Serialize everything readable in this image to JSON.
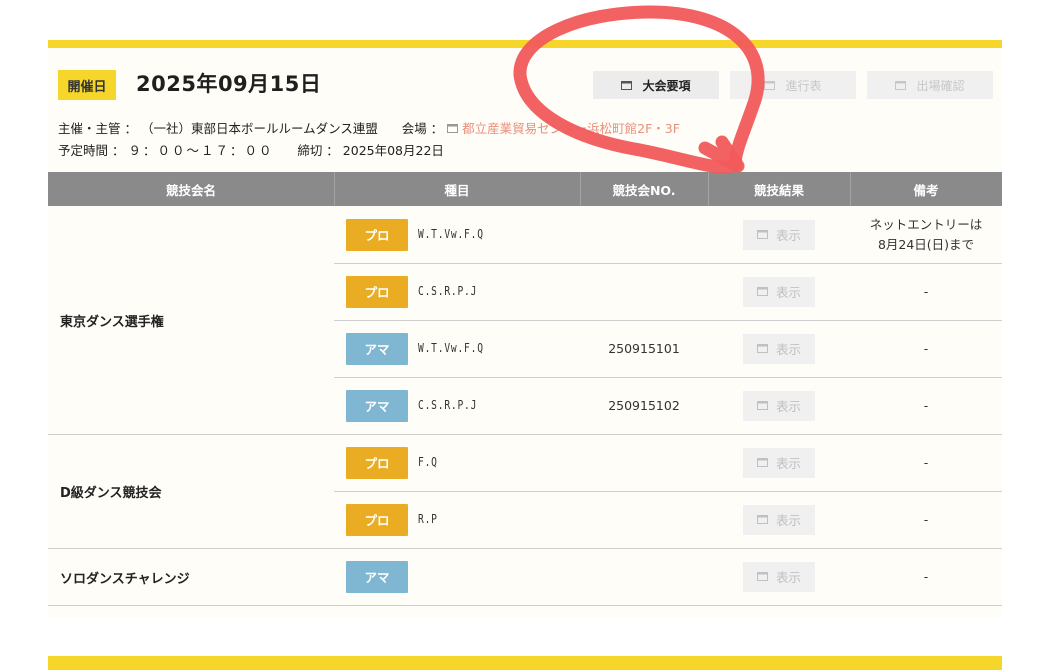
{
  "header": {
    "date_badge": "開催日",
    "date": "2025年09月15日",
    "buttons": [
      {
        "label": "大会要項",
        "state": "active"
      },
      {
        "label": "進行表",
        "state": "disabled"
      },
      {
        "label": "出場確認",
        "state": "disabled"
      }
    ]
  },
  "info": {
    "organizer_label": "主催・主管 ：",
    "organizer": "（一社）東部日本ボールルームダンス連盟",
    "venue_label": "会場 ：",
    "venue": "都立産業貿易センター浜松町館2F・3F",
    "time_label": "予定時間 ：",
    "time": "９：００〜１７：００",
    "deadline_label": "締切 ：",
    "deadline": "2025年08月22日"
  },
  "table": {
    "headers": [
      "競技会名",
      "種目",
      "競技会NO.",
      "競技結果",
      "備考"
    ],
    "show_label": "表示",
    "groups": [
      {
        "name": "東京ダンス選手権",
        "rows": [
          {
            "type": "プロ",
            "kind": "pro",
            "event": "W.T.Vw.F.Q",
            "no": "",
            "note": [
              "ネットエントリーは",
              "8月24日(日)まで"
            ]
          },
          {
            "type": "プロ",
            "kind": "pro",
            "event": "C.S.R.P.J",
            "no": "",
            "note": [
              "-"
            ]
          },
          {
            "type": "アマ",
            "kind": "ama",
            "event": "W.T.Vw.F.Q",
            "no": "250915101",
            "note": [
              "-"
            ]
          },
          {
            "type": "アマ",
            "kind": "ama",
            "event": "C.S.R.P.J",
            "no": "250915102",
            "note": [
              "-"
            ]
          }
        ]
      },
      {
        "name": "D級ダンス競技会",
        "rows": [
          {
            "type": "プロ",
            "kind": "pro",
            "event": "F.Q",
            "no": "",
            "note": [
              "-"
            ]
          },
          {
            "type": "プロ",
            "kind": "pro",
            "event": "R.P",
            "no": "",
            "note": [
              "-"
            ]
          }
        ]
      },
      {
        "name": "ソロダンスチャレンジ",
        "rows": [
          {
            "type": "アマ",
            "kind": "ama",
            "event": "",
            "no": "",
            "note": [
              "-"
            ]
          }
        ]
      }
    ]
  },
  "colors": {
    "accent_yellow": "#f7d62b",
    "pro_badge": "#e9ac22",
    "ama_badge": "#7fb6d2",
    "header_gray": "#8a8a8a",
    "venue_link": "#e8907c",
    "annotation_circle": "#f25a5a"
  },
  "icons": {
    "window": "window-icon",
    "annotation": "red-circle-annotation"
  }
}
